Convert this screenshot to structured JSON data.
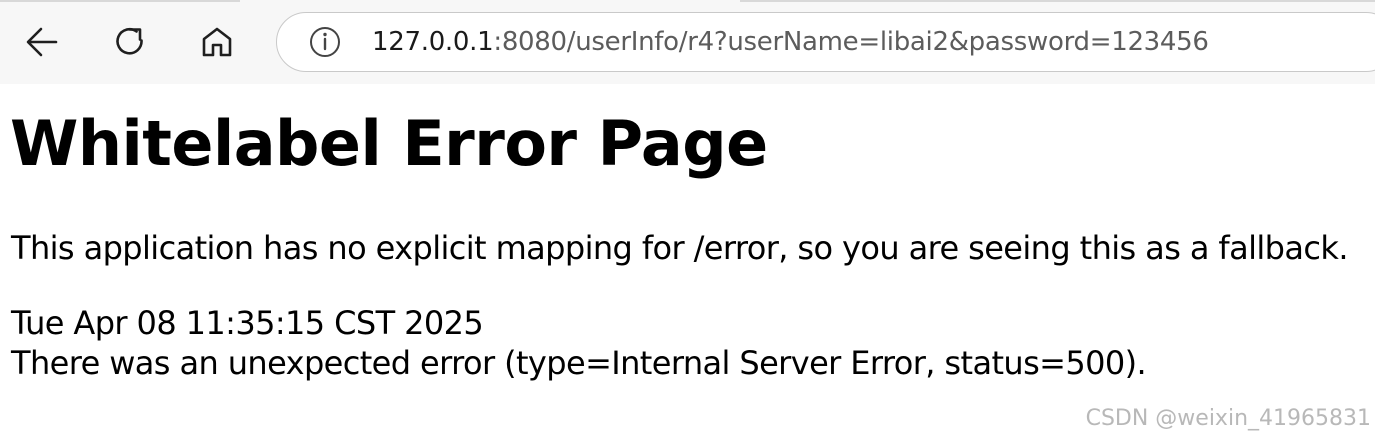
{
  "browser": {
    "back_icon": "back-arrow-icon",
    "reload_icon": "reload-icon",
    "home_icon": "home-icon",
    "info_icon": "info-icon",
    "address": {
      "host": "127.0.0.1",
      "rest": ":8080/userInfo/r4?userName=libai2&password=123456"
    }
  },
  "page": {
    "title": "Whitelabel Error Page",
    "message": "This application has no explicit mapping for /error, so you are seeing this as a fallback.",
    "timestamp": "Tue Apr 08 11:35:15 CST 2025",
    "error_detail": "There was an unexpected error (type=Internal Server Error, status=500)."
  },
  "watermark": "CSDN @weixin_41965831",
  "colors": {
    "toolbar_bg": "#f7f7f7",
    "address_border": "#c9c9c9",
    "url_host": "#1a1a1a",
    "url_rest": "#5c5c5c",
    "watermark": "#b8b8b8"
  }
}
